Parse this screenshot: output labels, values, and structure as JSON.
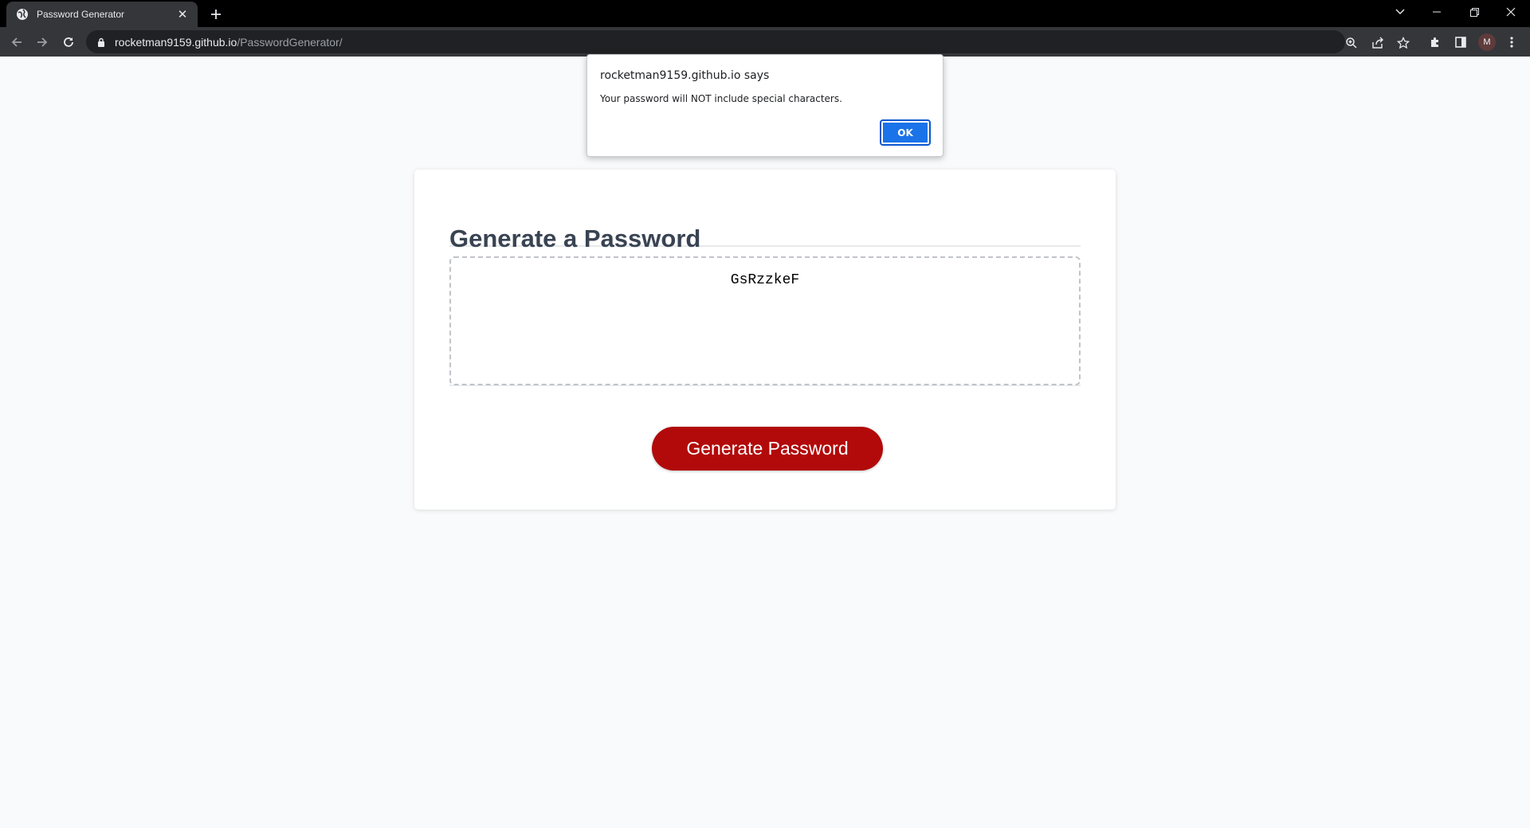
{
  "browser": {
    "tab": {
      "title": "Password Generator",
      "favicon": "globe-icon",
      "close": "close-icon"
    },
    "new_tab": "plus-icon",
    "url": {
      "host": "rocketman9159.github.io",
      "path": "/PasswordGenerator/"
    },
    "window_controls": [
      "tab-search-icon",
      "minimize-icon",
      "restore-icon",
      "close-icon"
    ],
    "toolbar_icons": [
      "zoom-icon",
      "share-icon",
      "bookmark-star-icon",
      "extensions-icon",
      "side-panel-icon",
      "menu-icon"
    ],
    "profile_initial": "M"
  },
  "dialog": {
    "title": "rocketman9159.github.io says",
    "message": "Your password will NOT include special characters.",
    "ok_label": "OK"
  },
  "card": {
    "title": "Generate a Password",
    "password": "GsRzzkeF",
    "button_label": "Generate Password"
  },
  "colors": {
    "button": "#b20a0a",
    "dialog_button": "#1a73e8",
    "title": "#394352",
    "page_background": "#f9fafb"
  }
}
